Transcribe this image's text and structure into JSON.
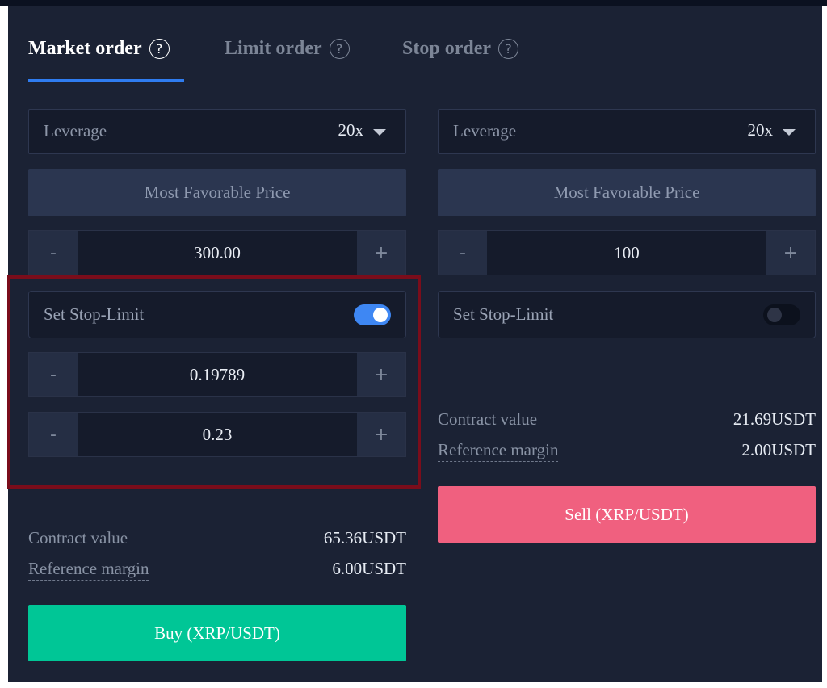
{
  "tabs": [
    {
      "label": "Market order",
      "help_icon": "?"
    },
    {
      "label": "Limit order",
      "help_icon": "?"
    },
    {
      "label": "Stop order",
      "help_icon": "?"
    }
  ],
  "buy": {
    "leverage_label": "Leverage",
    "leverage_value": "20x",
    "price_button": "Most Favorable Price",
    "amount": "300.00",
    "stop_limit_label": "Set Stop-Limit",
    "stop_limit_enabled": true,
    "stop_price": "0.19789",
    "limit_price": "0.23",
    "contract_value_label": "Contract value",
    "contract_value": "65.36USDT",
    "reference_margin_label": "Reference margin",
    "reference_margin": "6.00USDT",
    "action_label": "Buy (XRP/USDT)"
  },
  "sell": {
    "leverage_label": "Leverage",
    "leverage_value": "20x",
    "price_button": "Most Favorable Price",
    "amount": "100",
    "stop_limit_label": "Set Stop-Limit",
    "stop_limit_enabled": false,
    "contract_value_label": "Contract value",
    "contract_value": "21.69USDT",
    "reference_margin_label": "Reference margin",
    "reference_margin": "2.00USDT",
    "action_label": "Sell (XRP/USDT)"
  },
  "stepper": {
    "minus": "-",
    "plus": "+"
  },
  "colors": {
    "accent": "#2f7cf0",
    "buy": "#00c696",
    "sell": "#f0607f",
    "highlight_border": "#7a0d1b"
  }
}
